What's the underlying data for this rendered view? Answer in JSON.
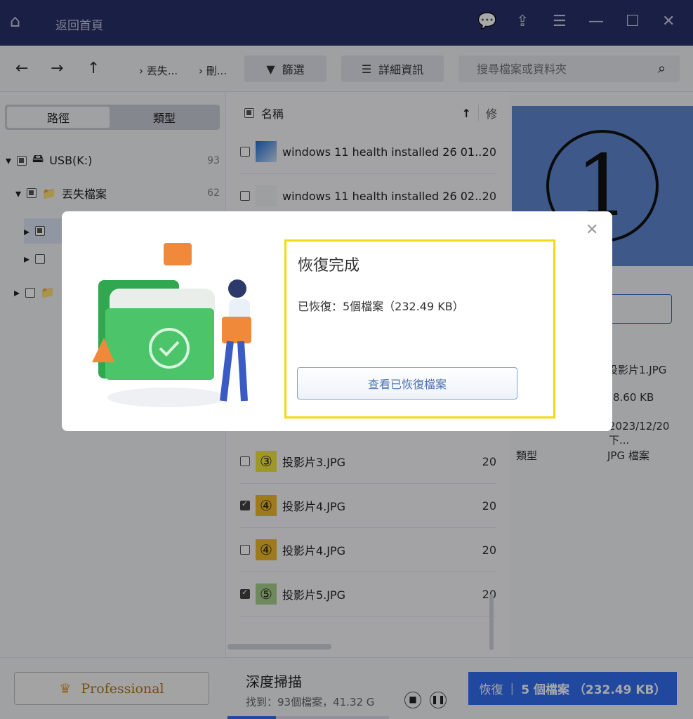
{
  "titlebar": {
    "home_label": "返回首頁",
    "icons": [
      "home-icon",
      "feedback-icon",
      "upload-icon",
      "menu-icon",
      "minimize-icon",
      "maximize-icon",
      "close-icon"
    ]
  },
  "toolbar": {
    "breadcrumb": [
      "丟失...",
      "刪..."
    ],
    "filter_label": "篩選",
    "details_label": "詳細資訊",
    "search_placeholder": "搜尋檔案或資料夾"
  },
  "left": {
    "tabs": [
      "路徑",
      "類型"
    ],
    "tree": [
      {
        "label": "USB(K:)",
        "count": "93"
      },
      {
        "label": "丟失檔案",
        "count": "62"
      }
    ]
  },
  "list": {
    "header": {
      "name": "名稱",
      "modified": "修"
    },
    "rows": [
      {
        "name": "windows 11 health installed 26 01...",
        "date": "20",
        "checked": false,
        "thumb": "win"
      },
      {
        "name": "windows 11 health installed 26 02...",
        "date": "20",
        "checked": false,
        "thumb": "blank"
      },
      {
        "name": "投影片3.JPG",
        "date": "20",
        "checked": false,
        "thumb": "③"
      },
      {
        "name": "投影片4.JPG",
        "date": "20",
        "checked": true,
        "thumb": "④"
      },
      {
        "name": "投影片4.JPG",
        "date": "20",
        "checked": false,
        "thumb": "④"
      },
      {
        "name": "投影片5.JPG",
        "date": "20",
        "checked": true,
        "thumb": "⑤"
      }
    ]
  },
  "preview": {
    "image_text": "1",
    "props": [
      {
        "k": "",
        "v": "投影片1.JPG"
      },
      {
        "k": "",
        "v": "8.60 KB"
      },
      {
        "k": "",
        "v": "2023/12/20 下..."
      },
      {
        "k": "類型",
        "v": "JPG 檔案"
      }
    ]
  },
  "bottom": {
    "pro_label": "Professional",
    "scan_title": "深度掃描",
    "scan_status": "找到：93個檔案，41.32 G",
    "recover_label": "恢復",
    "recover_detail": "5 個檔案 （232.49 KB）",
    "scan_progress": 0.3
  },
  "dialog": {
    "title": "恢復完成",
    "message": "已恢復：5個檔案（232.49 KB）",
    "view_button": "查看已恢復檔案"
  },
  "colors": {
    "accent": "#2f6ef0",
    "highlight": "#f5d90f",
    "titlebar": "#28306a"
  }
}
